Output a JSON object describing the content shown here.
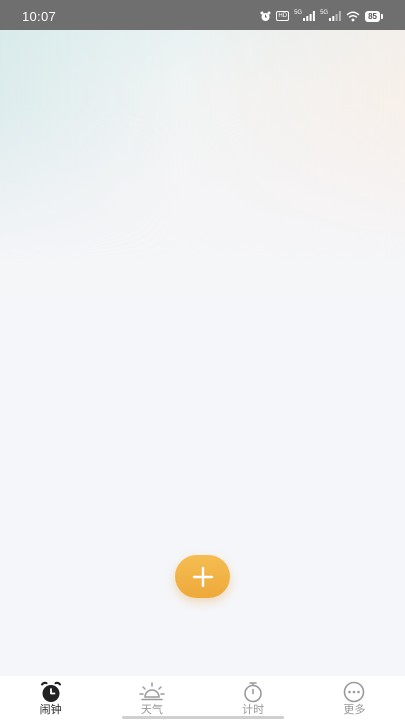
{
  "status_bar": {
    "time": "10:07",
    "hd_label": "HD",
    "net1_label": "5G",
    "net2_label": "5G",
    "battery": "85",
    "icons": [
      "alarm-icon",
      "hd-icon",
      "signal-icon",
      "signal-icon",
      "wifi-icon",
      "battery-icon"
    ]
  },
  "fab": {
    "icon": "plus-icon",
    "color": "#F0B040"
  },
  "tabs": [
    {
      "label": "闹钟",
      "icon": "alarm-clock-icon",
      "active": true
    },
    {
      "label": "天气",
      "icon": "sun-icon",
      "active": false
    },
    {
      "label": "计时",
      "icon": "stopwatch-icon",
      "active": false
    },
    {
      "label": "更多",
      "icon": "more-dots-icon",
      "active": false
    }
  ],
  "colors": {
    "accent": "#F0B040",
    "active_tab": "#222222",
    "inactive_tab": "#9A9A9A",
    "status_bar": "#6F6F6F"
  }
}
